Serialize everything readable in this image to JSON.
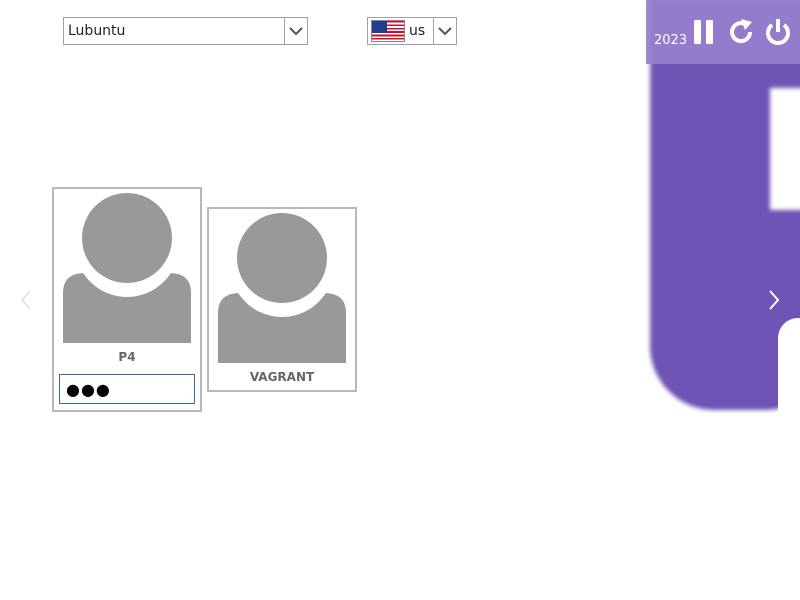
{
  "session_select": {
    "value": "Lubuntu"
  },
  "keyboard_select": {
    "value": "us",
    "flag": "us-flag-icon"
  },
  "clock": {
    "text": "2023"
  },
  "controls": [
    {
      "name": "suspend-button",
      "icon": "pause-icon"
    },
    {
      "name": "restart-button",
      "icon": "restart-icon"
    },
    {
      "name": "shutdown-button",
      "icon": "power-icon"
    }
  ],
  "users": [
    {
      "name": "P4",
      "password_mask": "●●●",
      "selected": true
    },
    {
      "name": "VAGRANT",
      "selected": false
    }
  ],
  "colors": {
    "accent": "#6e54b5",
    "panel": "#9680cd",
    "avatar": "#999999",
    "card_border": "#b8b8b8",
    "username": "#666666"
  }
}
